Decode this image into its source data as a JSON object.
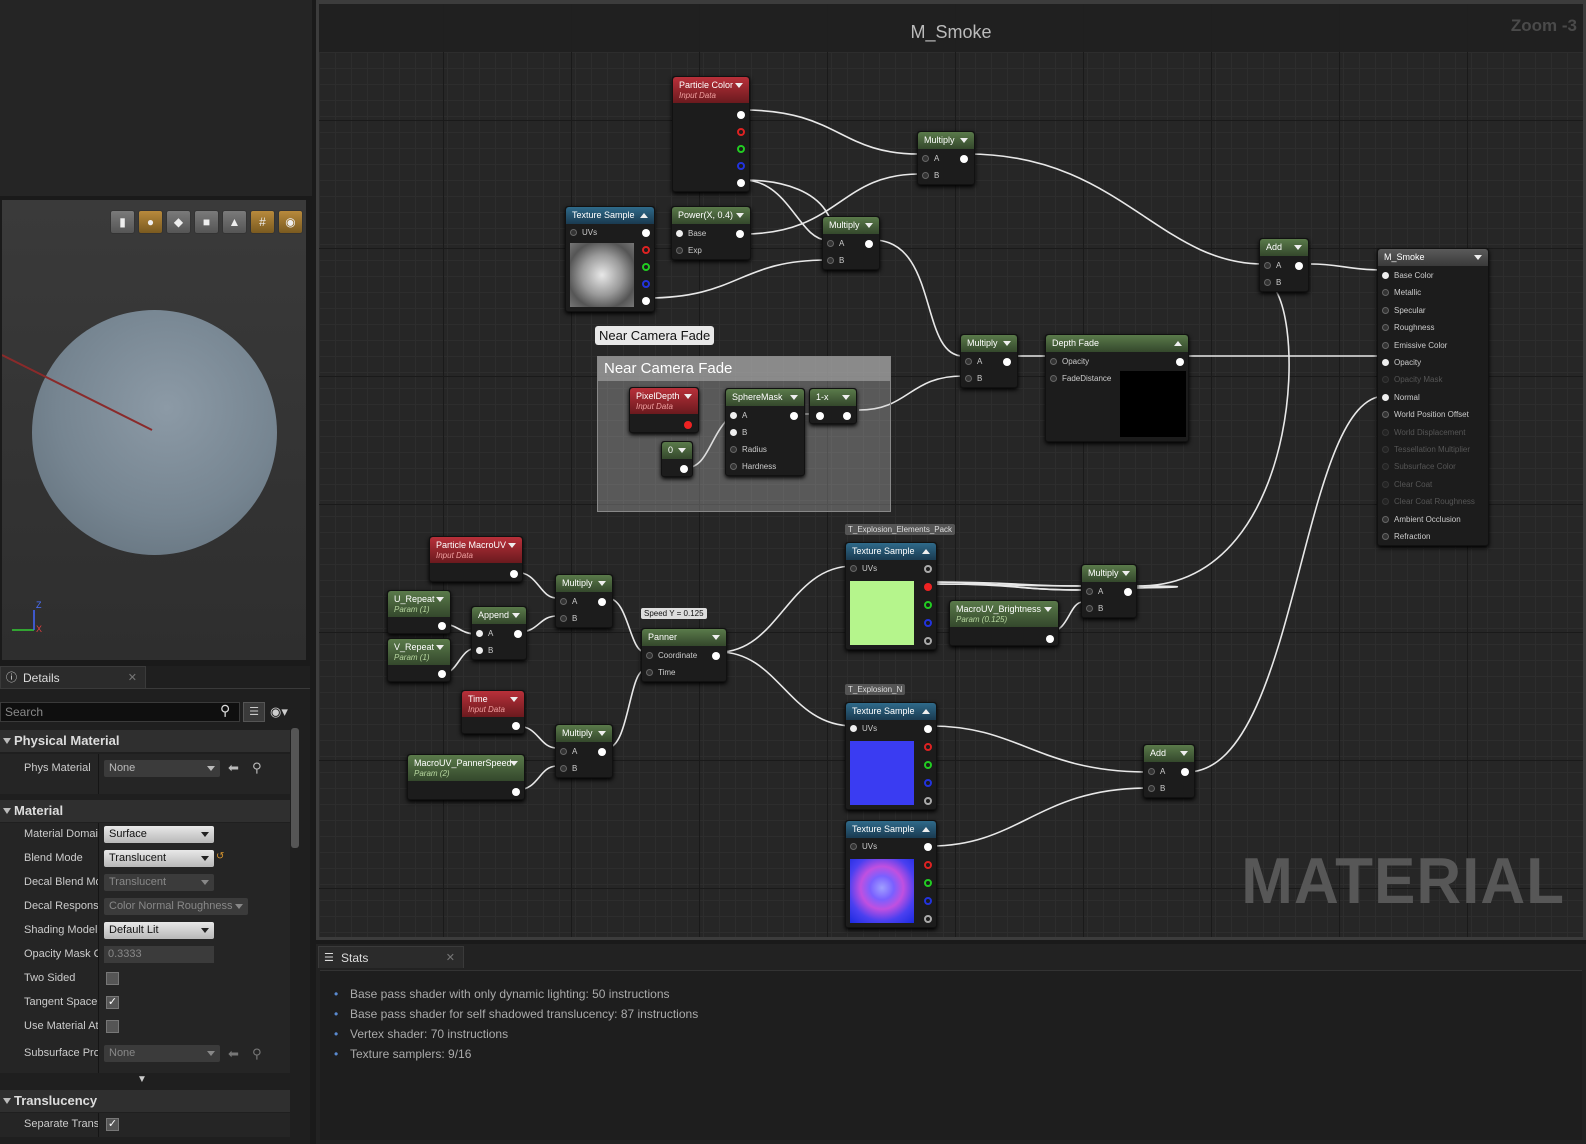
{
  "details": {
    "tab_label": "Details",
    "search_placeholder": "Search",
    "categories": {
      "physical_material": "Physical Material",
      "material": "Material",
      "translucency": "Translucency"
    },
    "props": {
      "phys_material": {
        "label": "Phys Material",
        "value": "None"
      },
      "material_domain": {
        "label": "Material Domain",
        "value": "Surface"
      },
      "blend_mode": {
        "label": "Blend Mode",
        "value": "Translucent"
      },
      "decal_blend_mode": {
        "label": "Decal Blend Mode",
        "value": "Translucent"
      },
      "decal_response": {
        "label": "Decal Response",
        "value": "Color Normal Roughness"
      },
      "shading_model": {
        "label": "Shading Model",
        "value": "Default Lit"
      },
      "opacity_mask": {
        "label": "Opacity Mask Clip Value",
        "value": "0.3333"
      },
      "two_sided": {
        "label": "Two Sided"
      },
      "tangent_space": {
        "label": "Tangent Space Normal"
      },
      "use_material_attributes": {
        "label": "Use Material Attributes"
      },
      "subsurface": {
        "label": "Subsurface Profile",
        "value": "None"
      },
      "separate_translucency": {
        "label": "Separate Translucency"
      }
    }
  },
  "viewport": {
    "axis_z": "Z",
    "axis_x": "X"
  },
  "graph": {
    "title": "M_Smoke",
    "zoom": "Zoom -3",
    "watermark": "MATERIAL",
    "comment_title": "Near Camera Fade",
    "comment_bubble": "Near Camera Fade",
    "nodes": {
      "particle_color": {
        "title": "Particle Color",
        "sub": "Input Data"
      },
      "texture_sample": "Texture Sample",
      "power": {
        "title": "Power(X, 0.4)",
        "base": "Base",
        "exp": "Exp"
      },
      "multiply": "Multiply",
      "add": "Add",
      "pin_a": "A",
      "pin_b": "B",
      "uvs": "UVs",
      "pixel_depth": {
        "title": "PixelDepth",
        "sub": "Input Data"
      },
      "sphere_mask": {
        "title": "SphereMask",
        "a": "A",
        "b": "B",
        "radius": "Radius",
        "hardness": "Hardness"
      },
      "one_minus": "1-x",
      "zero": "0",
      "depth_fade": {
        "title": "Depth Fade",
        "opacity": "Opacity",
        "fade_distance": "FadeDistance"
      },
      "particle_macrouv": {
        "title": "Particle MacroUV",
        "sub": "Input Data"
      },
      "u_repeat": {
        "title": "U_Repeat",
        "sub": "Param (1)"
      },
      "v_repeat": {
        "title": "V_Repeat",
        "sub": "Param (1)"
      },
      "append": "Append",
      "panner": {
        "title": "Panner",
        "coordinate": "Coordinate",
        "time": "Time",
        "bubble": "Speed Y = 0.125"
      },
      "time": {
        "title": "Time",
        "sub": "Input Data"
      },
      "macro_panner_speed": {
        "title": "MacroUV_PannerSpeed",
        "sub": "Param (2)"
      },
      "macro_brightness": {
        "title": "MacroUV_Brightness",
        "sub": "Param (0.125)"
      },
      "tex_explosion_pack": "T_Explosion_Elements_Pack",
      "tex_explosion_n": "T_Explosion_N",
      "result": {
        "title": "M_Smoke",
        "pins": [
          "Base Color",
          "Metallic",
          "Specular",
          "Roughness",
          "Emissive Color",
          "Opacity",
          "Opacity Mask",
          "Normal",
          "World Position Offset",
          "World Displacement",
          "Tessellation Multiplier",
          "Subsurface Color",
          "Clear Coat",
          "Clear Coat Roughness",
          "Ambient Occlusion",
          "Refraction"
        ]
      }
    }
  },
  "stats": {
    "tab_label": "Stats",
    "lines": [
      "Base pass shader with only dynamic lighting: 50 instructions",
      "Base pass shader for self shadowed translucency: 87 instructions",
      "Vertex shader: 70 instructions",
      "Texture samplers: 9/16"
    ]
  },
  "colors": {
    "accent_orange": "#d9962f",
    "param_green": "#5a7a4a",
    "input_red": "#b8303a",
    "texture_blue": "#2f6a8a"
  }
}
